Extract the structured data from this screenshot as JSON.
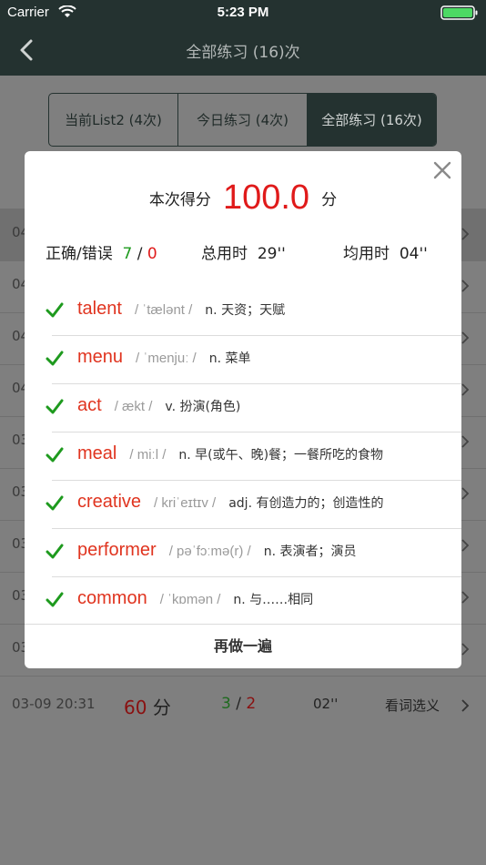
{
  "status_bar": {
    "carrier": "Carrier",
    "time": "5:23 PM"
  },
  "nav": {
    "title": "全部练习 (16)次"
  },
  "segments": [
    {
      "label": "当前List2 (4次)",
      "active": false
    },
    {
      "label": "今日练习 (4次)",
      "active": false
    },
    {
      "label": "全部练习 (16次)",
      "active": true
    }
  ],
  "background_rows": [
    "04",
    "04",
    "04",
    "04",
    "03",
    "03",
    "03",
    "03",
    "03"
  ],
  "last_row": {
    "date": "03-09 20:31",
    "score": "60",
    "score_unit": "分",
    "correct": "3",
    "slash": "/",
    "wrong": "2",
    "time": "02''",
    "type": "看词选义"
  },
  "modal": {
    "score_label": "本次得分",
    "score": "100.0",
    "score_unit": "分",
    "correct_wrong_label": "正确/错误",
    "correct": "7",
    "slash": "/",
    "wrong": "0",
    "total_time_label": "总用时",
    "total_time": "29''",
    "avg_time_label": "均用时",
    "avg_time": "04''",
    "words": [
      {
        "word": "talent",
        "phonetic": "/ ˈtælənt /",
        "meaning": "n. 天资；天赋"
      },
      {
        "word": "menu",
        "phonetic": "/ ˈmenjuː /",
        "meaning": "n. 菜单"
      },
      {
        "word": "act",
        "phonetic": "/ ækt /",
        "meaning": "v. 扮演(角色)"
      },
      {
        "word": "meal",
        "phonetic": "/ miːl /",
        "meaning": "n. 早(或午、晚)餐；一餐所吃的食物"
      },
      {
        "word": "creative",
        "phonetic": "/ kriˈeɪtɪv /",
        "meaning": "adj. 有创造力的；创造性的"
      },
      {
        "word": "performer",
        "phonetic": "/ pəˈfɔːmə(r) /",
        "meaning": "n. 表演者；演员"
      },
      {
        "word": "common",
        "phonetic": "/ ˈkɒmən /",
        "meaning": "n. 与……相同"
      }
    ],
    "redo_label": "再做一遍"
  },
  "colors": {
    "nav_bg": "#243230",
    "score_red": "#e01a1a",
    "word_red": "#e0341f",
    "check_green": "#1e9a1e"
  }
}
